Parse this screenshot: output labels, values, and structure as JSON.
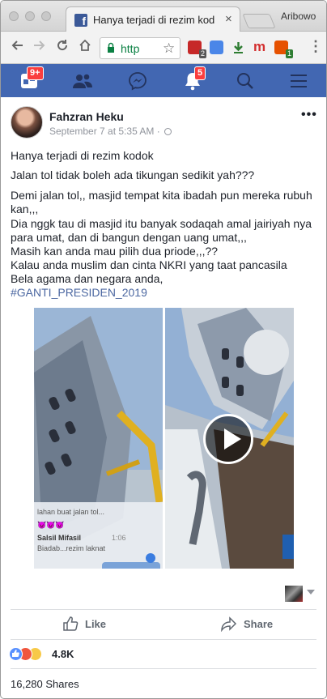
{
  "browser": {
    "tab_title": "Hanya terjadi di rezim kodok",
    "tab_close": "×",
    "profile_name": "Aribowo",
    "url_text": "http",
    "extension_badges": [
      "2",
      "1"
    ]
  },
  "fb_nav": {
    "feed_badge": "9+",
    "notifications_badge": "5"
  },
  "post": {
    "author": "Fahzran Heku",
    "timestamp": "September 7 at 5:35 AM · ",
    "more_label": "•••",
    "paragraphs": [
      "Hanya terjadi di rezim kodok",
      "Jalan tol tidak boleh ada tikungan sedikit yah???",
      "Demi jalan tol,, masjid tempat kita ibadah pun mereka rubuh kan,,,"
    ],
    "paragraph_lines": [
      "Dia nggk tau di masjid itu banyak sodaqah amal jairiyah nya para umat, dan di bangun dengan uang umat,,,",
      "Masih kan anda mau pilih dua priode,,,??",
      "Kalau anda muslim dan cinta NKRI yang taat pancasila",
      "Bela agama dan negara anda,"
    ],
    "hashtag": "#GANTI_PRESIDEN_2019",
    "video_overlay": {
      "comment_1": "lahan buat jalan tol...",
      "comment_2_name": "Salsil Mifasil",
      "comment_2_time": "1:06",
      "comment_2_text": "Biadab...rezim laknat"
    },
    "actions": {
      "like": "Like",
      "share": "Share"
    },
    "reaction_count": "4.8K",
    "shares": "16,280 Shares"
  },
  "colors": {
    "facebook_blue": "#4267b2",
    "notification_red": "#fa3e3e",
    "hashtag_blue": "#4b67a1",
    "secure_green": "#0b8043"
  },
  "icons": [
    "facebook-favicon",
    "back-arrow-icon",
    "forward-arrow-icon",
    "reload-icon",
    "home-icon",
    "lock-icon",
    "star-icon",
    "news-feed-icon",
    "friends-icon",
    "messenger-icon",
    "bell-icon",
    "search-icon",
    "menu-icon",
    "globe-icon",
    "play-icon",
    "like-icon",
    "share-icon",
    "like-reaction-icon",
    "angry-reaction-icon",
    "sad-reaction-icon"
  ]
}
